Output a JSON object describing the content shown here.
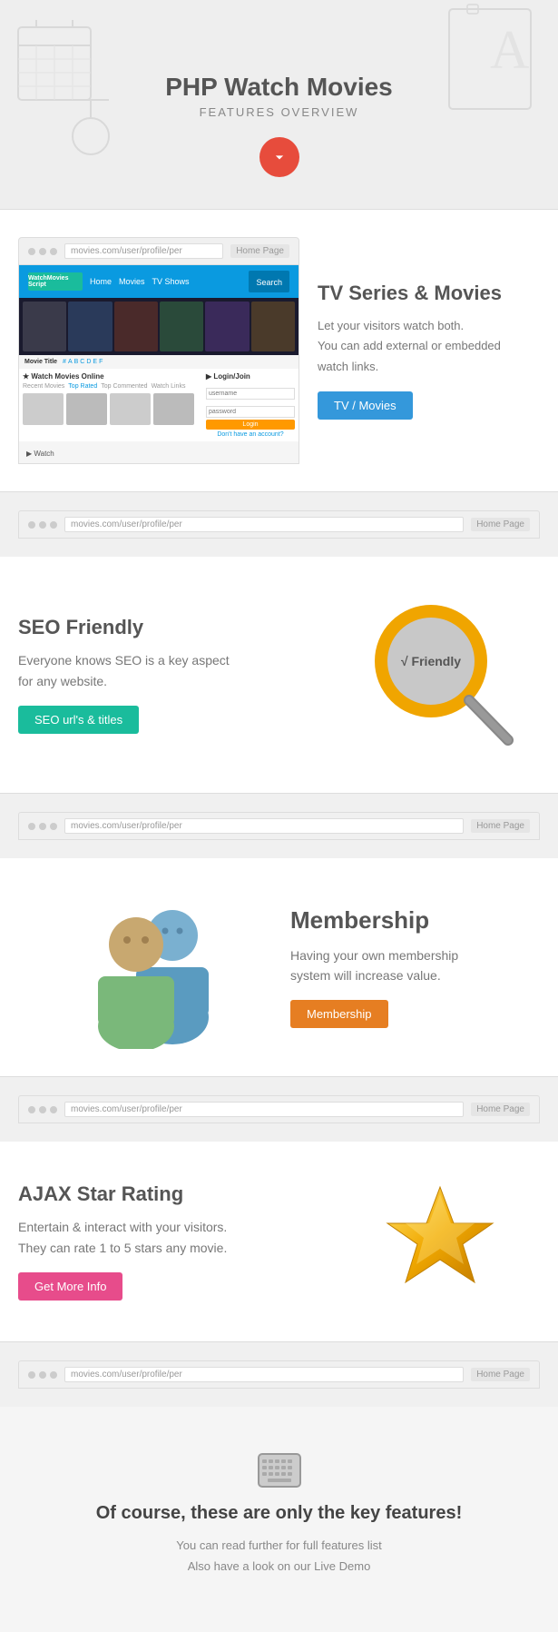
{
  "hero": {
    "title": "PHP Watch Movies",
    "subtitle": "FEATURES OVERVIEW",
    "arrow_label": "scroll down"
  },
  "tv_section": {
    "heading": "TV Series & Movies",
    "description": "Let your visitors watch both.\nYou can add external or embedded\nwatch links.",
    "button_label": "TV / Movies",
    "browser_url": "movies.com/user/profile/per",
    "browser_btn": "Home Page"
  },
  "seo_section": {
    "heading": "SEO Friendly",
    "description": "Everyone knows SEO is a key aspect\nfor any website.",
    "button_label": "SEO url's & titles",
    "magnifier_text": "√ Friendly"
  },
  "membership_section": {
    "heading": "Membership",
    "description": "Having your own membership\nsystem will increase value.",
    "button_label": "Membership",
    "browser_url": "movies.com/user/profile/per",
    "browser_btn": "Home Page"
  },
  "star_section": {
    "heading": "AJAX Star Rating",
    "description": "Entertain & interact with your visitors.\nThey can rate 1 to 5 stars any movie.",
    "button_label": "Get More Info",
    "browser_url": "movies.com/user/profile/per",
    "browser_btn": "Home Page"
  },
  "footer": {
    "heading": "Of course, these are only the key features!",
    "line1": "You can read further for full features list",
    "line2": "Also have a look on our Live Demo"
  }
}
